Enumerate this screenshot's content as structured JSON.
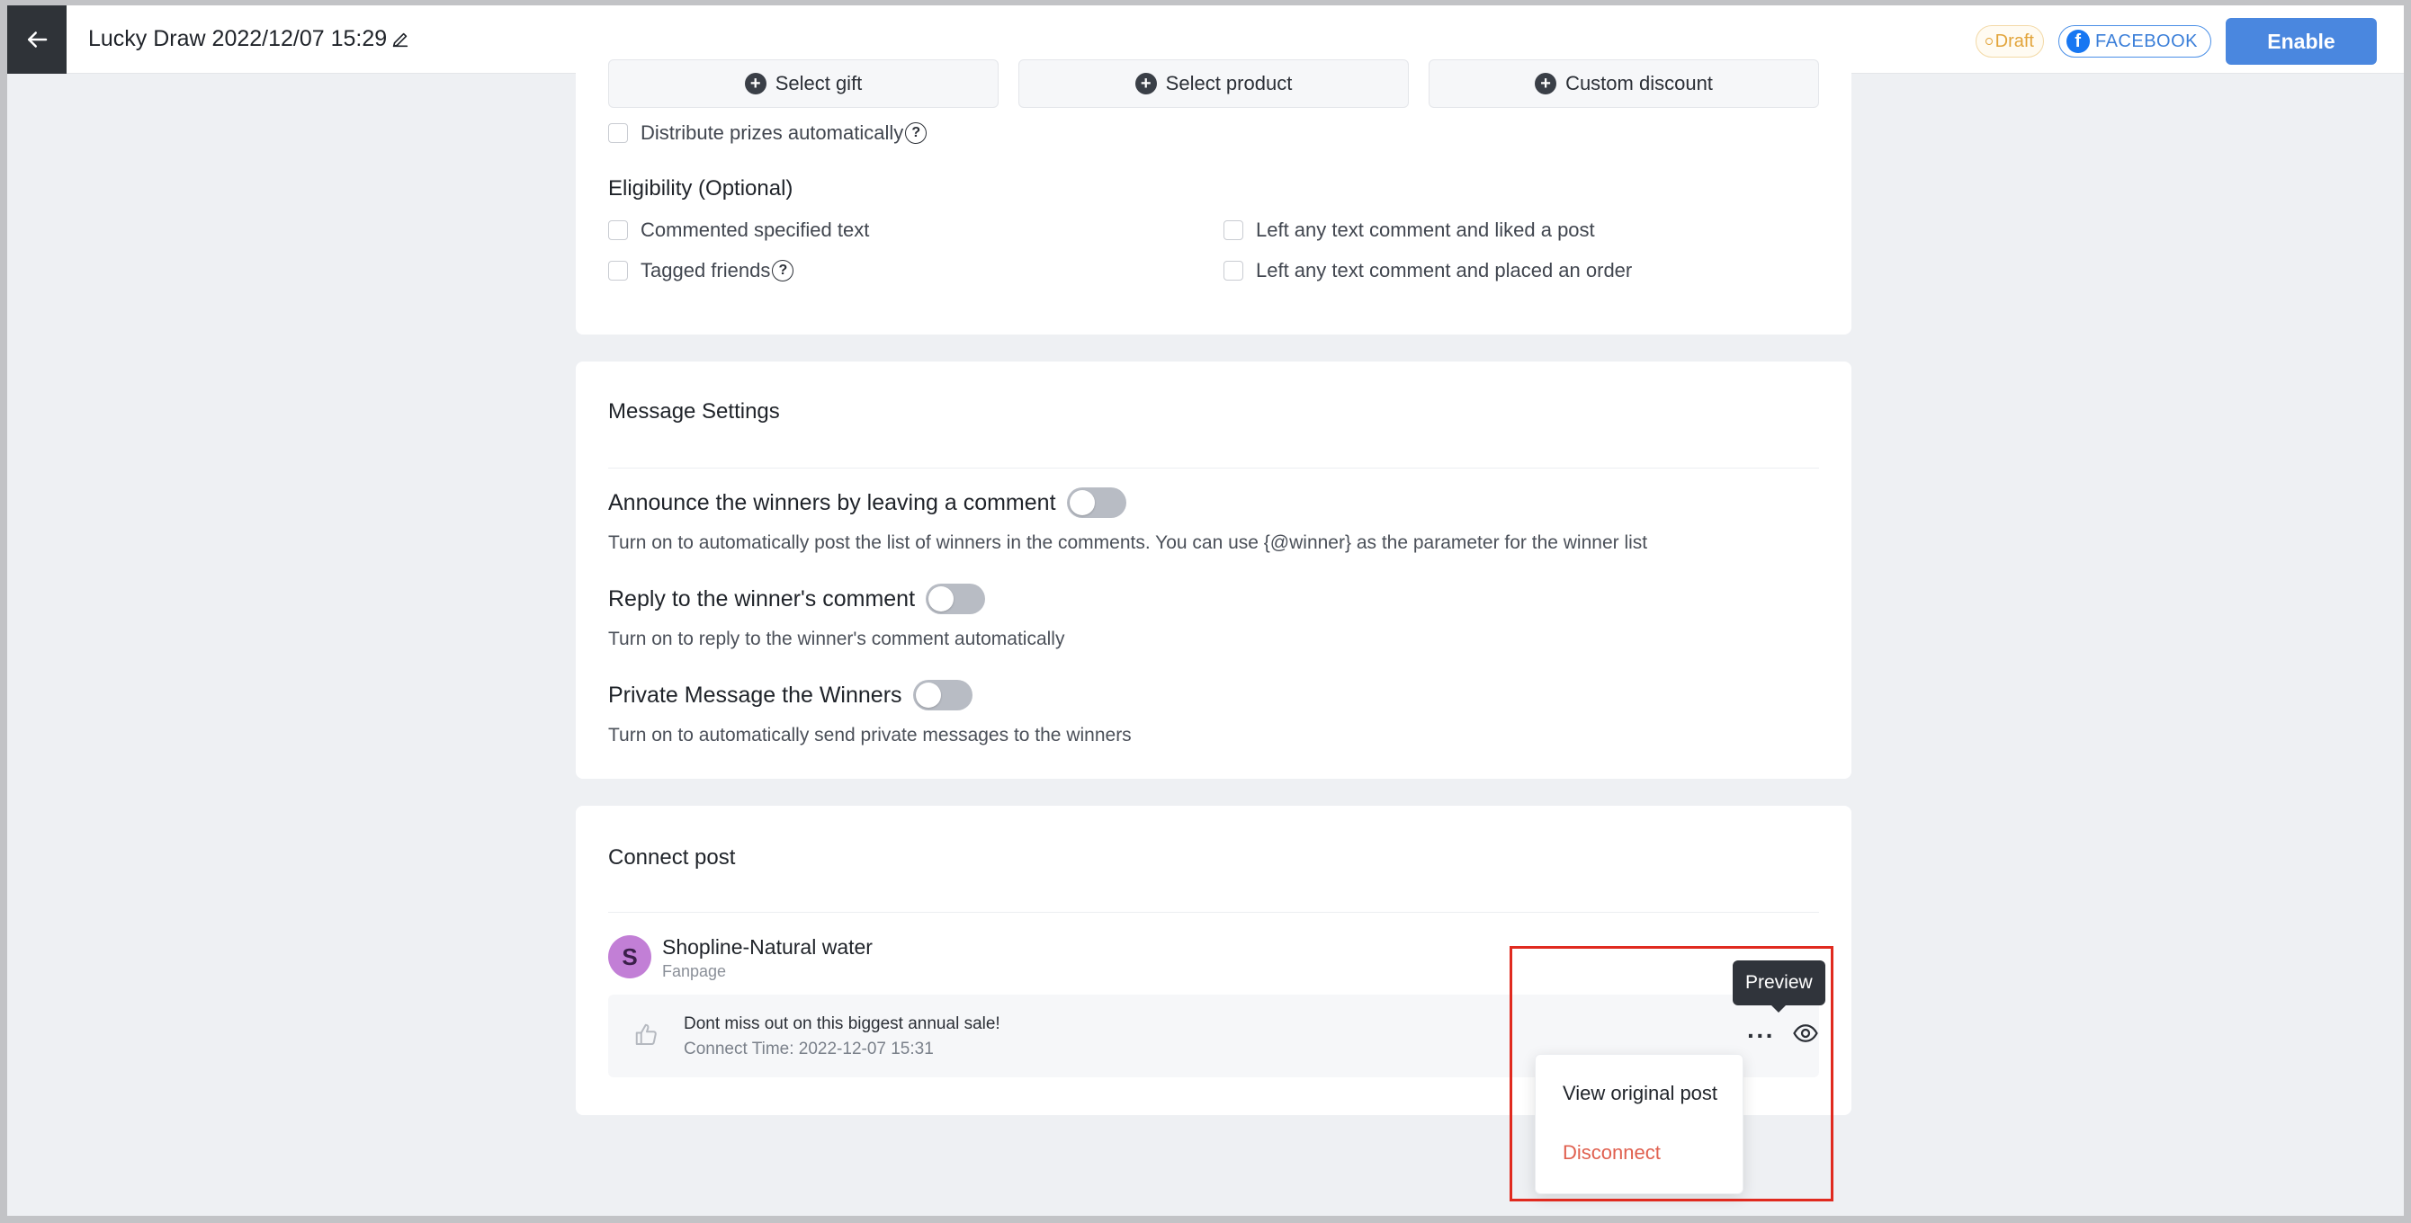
{
  "header": {
    "title": "Lucky Draw 2022/12/07 15:29",
    "status_badge": "Draft",
    "platform_badge": "FACEBOOK",
    "enable_label": "Enable"
  },
  "prizes": {
    "select_gift": "Select gift",
    "select_product": "Select product",
    "custom_discount": "Custom discount",
    "distribute_auto": "Distribute prizes automatically"
  },
  "eligibility": {
    "title": "Eligibility (Optional)",
    "options": [
      "Commented specified text",
      "Left any text comment and liked a post",
      "Tagged friends",
      "Left any text comment and placed an order"
    ]
  },
  "message_settings": {
    "title": "Message Settings",
    "items": [
      {
        "title": "Announce the winners by leaving a comment",
        "desc": "Turn on to automatically post the list of winners in the comments. You can use {@winner} as the parameter for the winner list"
      },
      {
        "title": "Reply to the winner's comment",
        "desc": "Turn on to reply to the winner's comment automatically"
      },
      {
        "title": "Private Message the Winners",
        "desc": "Turn on to automatically send private messages to the winners"
      }
    ]
  },
  "connect_post": {
    "title": "Connect post",
    "avatar_letter": "S",
    "page_name": "Shopline-Natural water",
    "page_type": "Fanpage",
    "post_text": "Dont miss out on this biggest annual sale!",
    "connect_time": "Connect Time: 2022-12-07 15:31",
    "more_label": "···"
  },
  "tooltip": "Preview",
  "menu": {
    "view_original": "View original post",
    "disconnect": "Disconnect"
  },
  "colors": {
    "accent": "#4a87df",
    "danger": "#e0604f",
    "draft": "#e2a43a",
    "highlight": "#e02a1f"
  }
}
